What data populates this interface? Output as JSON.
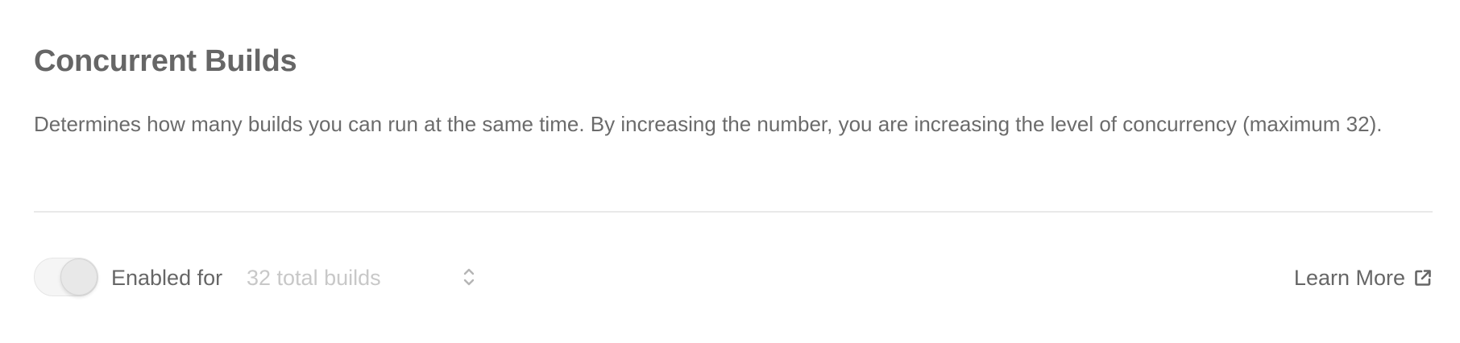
{
  "section": {
    "title": "Concurrent Builds",
    "description": "Determines how many builds you can run at the same time. By increasing the number, you are increasing the level of concurrency (maximum 32)."
  },
  "controls": {
    "toggle_enabled": true,
    "enabled_label": "Enabled for",
    "select_value": "32 total builds",
    "learn_more_label": "Learn More"
  },
  "icons": {
    "select": "chevron-up-down-icon",
    "learn_more": "external-link-icon"
  },
  "colors": {
    "text": "#666666",
    "muted": "#c8c8c8",
    "divider": "#e9e9e9"
  }
}
